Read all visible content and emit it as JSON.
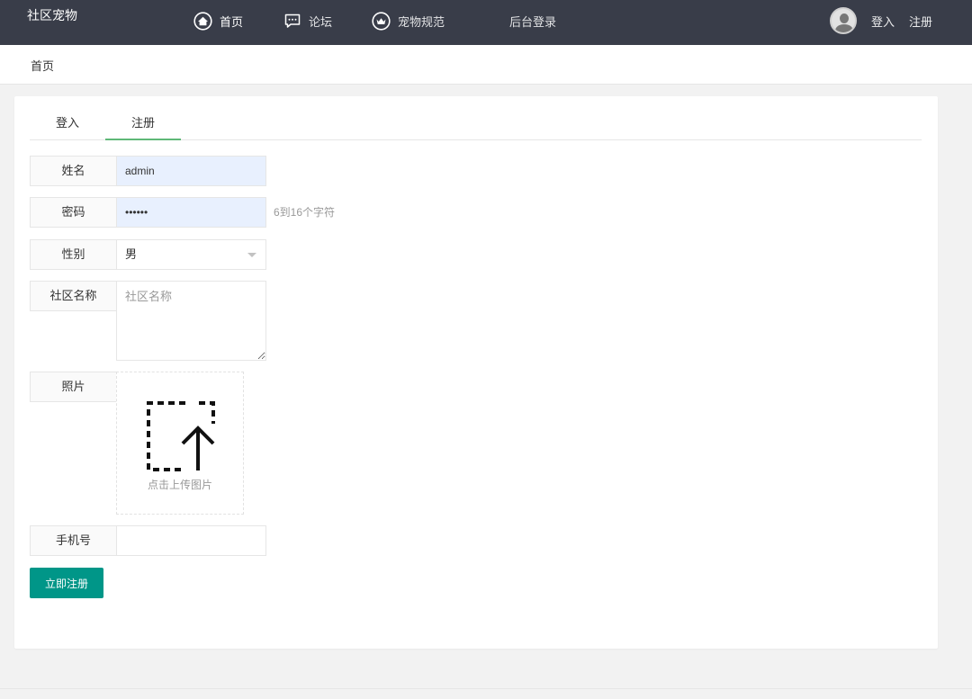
{
  "header": {
    "brand": "社区宠物",
    "nav": [
      {
        "label": "首页",
        "icon": "home-icon"
      },
      {
        "label": "论坛",
        "icon": "chat-icon"
      },
      {
        "label": "宠物规范",
        "icon": "pet-icon"
      },
      {
        "label": "后台登录",
        "icon": ""
      }
    ],
    "user": {
      "avatar_icon": "avatar-icon",
      "login": "登入",
      "register": "注册"
    }
  },
  "breadcrumb": {
    "home": "首页"
  },
  "tabs": [
    {
      "label": "登入"
    },
    {
      "label": "注册"
    }
  ],
  "form": {
    "name": {
      "label": "姓名",
      "value": "admin"
    },
    "password": {
      "label": "密码",
      "value": "••••••",
      "hint": "6到16个字符"
    },
    "gender": {
      "label": "性别",
      "value": "男"
    },
    "community": {
      "label": "社区名称",
      "placeholder": "社区名称"
    },
    "photo": {
      "label": "照片",
      "upload_text": "点击上传图片",
      "icon": "upload-icon"
    },
    "phone": {
      "label": "手机号",
      "value": ""
    },
    "submit_label": "立即注册"
  },
  "colors": {
    "topbar": "#393d49",
    "accent_button": "#009688",
    "tab_underline": "#5fb878",
    "autofill": "#e8f0fe"
  }
}
